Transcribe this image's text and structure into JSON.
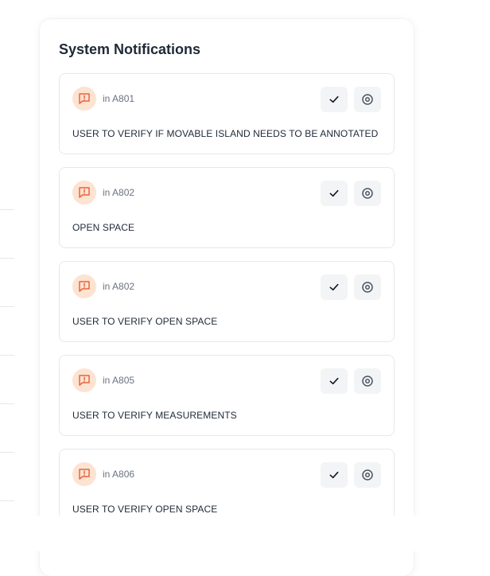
{
  "panel": {
    "title": "System Notifications"
  },
  "notifications": [
    {
      "location": "in A801",
      "message": "USER TO VERIFY IF MOVABLE ISLAND NEEDS TO BE ANNOTATED"
    },
    {
      "location": "in A802",
      "message": "OPEN SPACE"
    },
    {
      "location": "in A802",
      "message": "USER TO VERIFY OPEN SPACE"
    },
    {
      "location": "in A805",
      "message": "USER TO VERIFY MEASUREMENTS"
    },
    {
      "location": "in A806",
      "message": "USER TO VERIFY OPEN SPACE"
    }
  ],
  "icons": {
    "alert": "message-alert-icon",
    "check": "check-icon",
    "view": "target-icon"
  },
  "colors": {
    "alert_bg": "#fde3d2",
    "alert_fg": "#e8643c",
    "button_bg": "#f3f4f6",
    "card_border": "#e5e7eb"
  }
}
